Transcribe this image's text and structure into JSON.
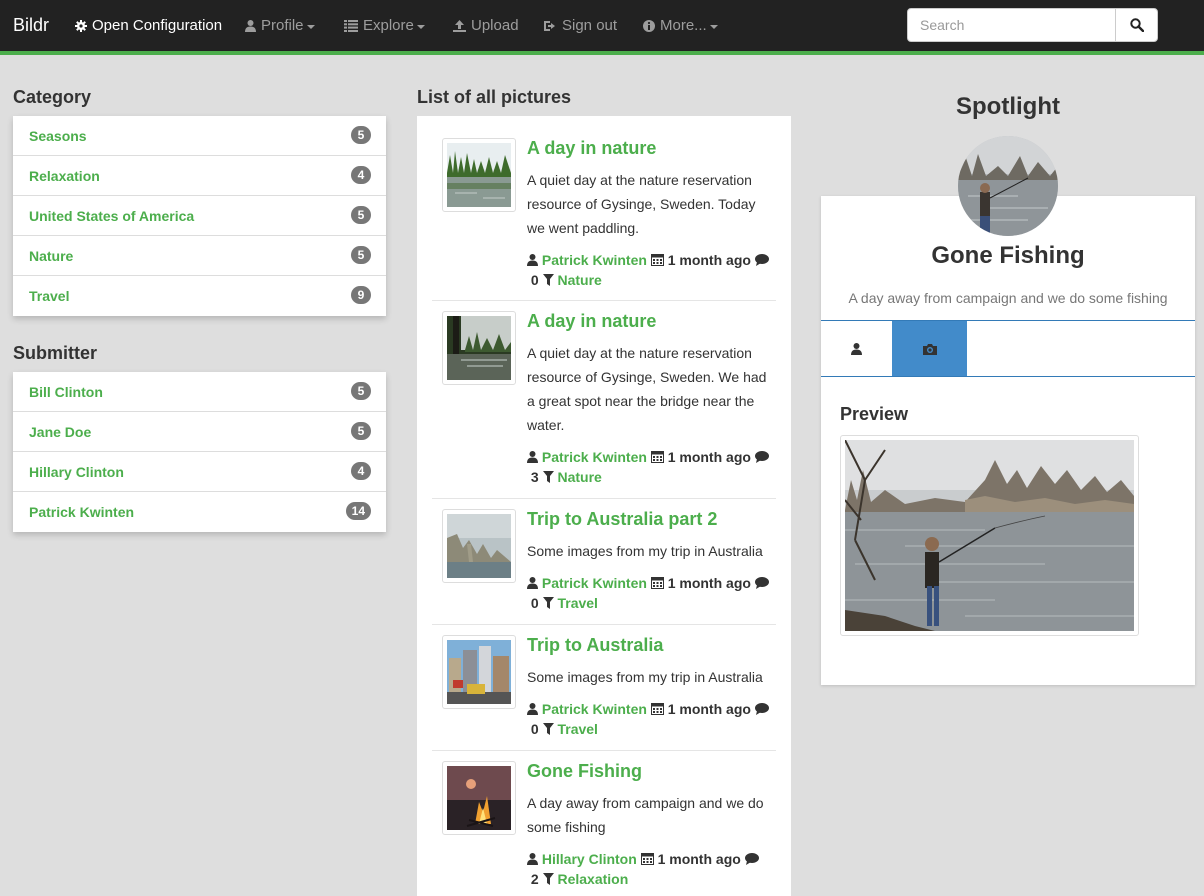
{
  "navbar": {
    "brand": "Bildr",
    "items": [
      {
        "label": "Open Configuration",
        "icon": "gear-icon"
      },
      {
        "label": "Profile",
        "icon": "user-icon"
      },
      {
        "label": "Explore",
        "icon": "list-icon"
      },
      {
        "label": "Upload",
        "icon": "upload-icon"
      },
      {
        "label": "Sign out",
        "icon": "sign-out-icon"
      },
      {
        "label": "More...",
        "icon": "info-icon"
      }
    ],
    "search_placeholder": "Search"
  },
  "category": {
    "title": "Category",
    "items": [
      {
        "label": "Seasons",
        "count": "5"
      },
      {
        "label": "Relaxation",
        "count": "4"
      },
      {
        "label": "United States of America",
        "count": "5"
      },
      {
        "label": "Nature",
        "count": "5"
      },
      {
        "label": "Travel",
        "count": "9"
      }
    ]
  },
  "submitter": {
    "title": "Submitter",
    "items": [
      {
        "label": "Bill Clinton",
        "count": "5"
      },
      {
        "label": "Jane Doe",
        "count": "5"
      },
      {
        "label": "Hillary Clinton",
        "count": "4"
      },
      {
        "label": "Patrick Kwinten",
        "count": "14"
      }
    ]
  },
  "pictures": {
    "title": "List of all pictures",
    "items": [
      {
        "title": "A day in nature",
        "desc": "A quiet day at the nature reservation resource of Gysinge, Sweden. Today we went paddling.",
        "author": "Patrick Kwinten",
        "time": "1 month ago",
        "comments": "0",
        "category": "Nature"
      },
      {
        "title": "A day in nature",
        "desc": "A quiet day at the nature reservation resource of Gysinge, Sweden. We had a great spot near the bridge near the water.",
        "author": "Patrick Kwinten",
        "time": "1 month ago",
        "comments": "3",
        "category": "Nature"
      },
      {
        "title": "Trip to Australia part 2",
        "desc": "Some images from my trip in Australia",
        "author": "Patrick Kwinten",
        "time": "1 month ago",
        "comments": "0",
        "category": "Travel"
      },
      {
        "title": "Trip to Australia",
        "desc": "Some images from my trip in Australia",
        "author": "Patrick Kwinten",
        "time": "1 month ago",
        "comments": "0",
        "category": "Travel"
      },
      {
        "title": "Gone Fishing",
        "desc": "A day away from campaign and we do some fishing",
        "author": "Hillary Clinton",
        "time": "1 month ago",
        "comments": "2",
        "category": "Relaxation"
      }
    ]
  },
  "spotlight": {
    "title": "Spotlight",
    "name": "Gone Fishing",
    "desc": "A day away from campaign and we do some fishing",
    "tabs": [
      "user-icon",
      "camera-icon"
    ],
    "preview_title": "Preview"
  },
  "colors": {
    "accent": "#4cae4c",
    "navbar": "#222222",
    "tab_active": "#428bca",
    "background": "#dedede"
  }
}
